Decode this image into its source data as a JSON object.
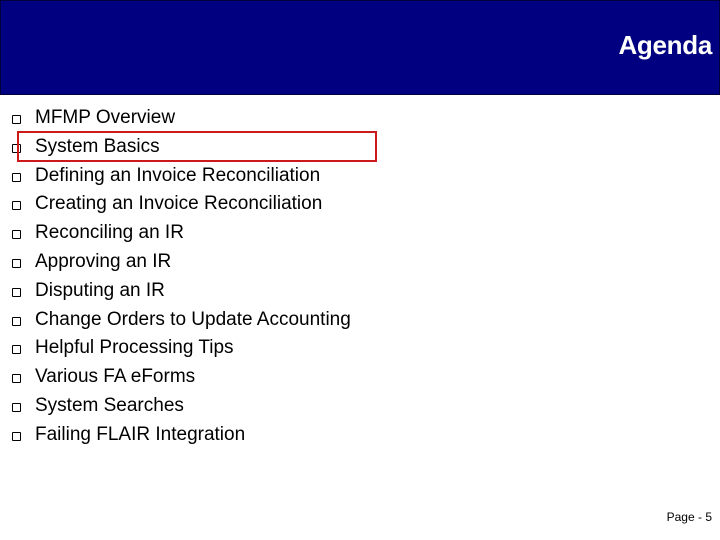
{
  "header": {
    "title": "Agenda",
    "background_color": "#000080"
  },
  "agenda": {
    "items": [
      {
        "label": "MFMP Overview"
      },
      {
        "label": "System Basics",
        "highlighted": true
      },
      {
        "label": "Defining an Invoice Reconciliation"
      },
      {
        "label": "Creating an Invoice Reconciliation"
      },
      {
        "label": "Reconciling an IR"
      },
      {
        "label": "Approving an IR"
      },
      {
        "label": "Disputing an IR"
      },
      {
        "label": "Change Orders to Update Accounting"
      },
      {
        "label": "Helpful Processing Tips"
      },
      {
        "label": "Various FA eForms"
      },
      {
        "label": "System Searches"
      },
      {
        "label": "Failing FLAIR Integration"
      }
    ],
    "bullet_icon": "hollow-square",
    "highlight_color": "#cc1a1a"
  },
  "footer": {
    "page_label": "Page - 5"
  }
}
